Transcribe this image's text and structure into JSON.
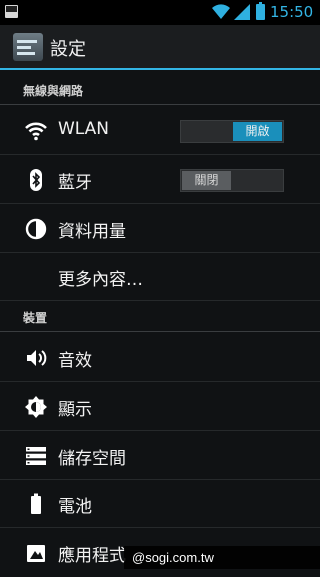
{
  "status_bar": {
    "time": "15:50"
  },
  "action_bar": {
    "title": "設定"
  },
  "sections": {
    "wireless": "無線與網路",
    "device": "裝置"
  },
  "rows": {
    "wlan": {
      "label": "WLAN",
      "toggle_label": "開啟",
      "state": "on"
    },
    "bluetooth": {
      "label": "藍牙",
      "toggle_label": "關閉",
      "state": "off"
    },
    "data_usage": {
      "label": "資料用量"
    },
    "more": {
      "label": "更多內容…"
    },
    "sound": {
      "label": "音效"
    },
    "display": {
      "label": "顯示"
    },
    "storage": {
      "label": "儲存空間"
    },
    "battery": {
      "label": "電池"
    },
    "apps": {
      "label": "應用程式"
    }
  },
  "watermark": "@sogi.com.tw",
  "colors": {
    "accent": "#33b5e5",
    "toggle_on": "#1a8fbb",
    "background": "#101214"
  }
}
